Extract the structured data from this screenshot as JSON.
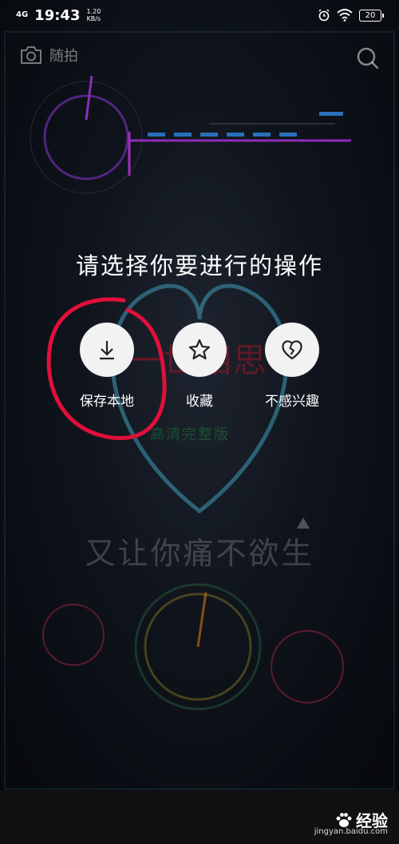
{
  "status_bar": {
    "network": "4G",
    "time": "19:43",
    "speed_value": "1.20",
    "speed_unit": "KB/s",
    "battery": "20"
  },
  "top_bar": {
    "shoot_label": "随拍"
  },
  "background": {
    "song_title": "一世相思",
    "hd_label": "高清完整版",
    "lyric": "又让你痛不欲生"
  },
  "dialog": {
    "prompt": "请选择你要进行的操作",
    "actions": [
      {
        "label": "保存本地",
        "icon": "download-icon"
      },
      {
        "label": "收藏",
        "icon": "star-icon"
      },
      {
        "label": "不感兴趣",
        "icon": "broken-heart-icon"
      }
    ]
  },
  "watermark": {
    "brand": "经验",
    "url": "jingyan.baidu.com"
  },
  "colors": {
    "highlight_ring": "#e0103a",
    "heart_glow": "#5ad8ff",
    "visualizer_pink": "#d63cff",
    "visualizer_blue": "#3aa0ff"
  }
}
